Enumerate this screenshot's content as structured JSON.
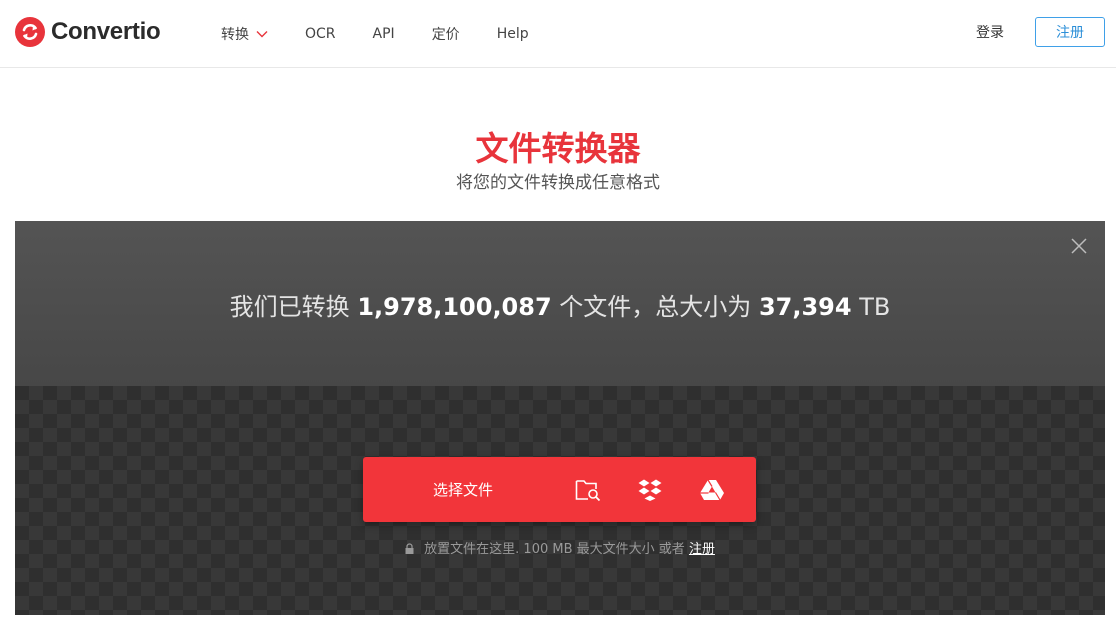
{
  "header": {
    "logo_text": "Convertio",
    "logo_icon": "convertio-logo-icon",
    "nav": [
      {
        "label": "转换",
        "has_dropdown": true
      },
      {
        "label": "OCR"
      },
      {
        "label": "API"
      },
      {
        "label": "定价"
      },
      {
        "label": "Help"
      }
    ],
    "login_label": "登录",
    "signup_label": "注册"
  },
  "hero": {
    "title": "文件转换器",
    "subtitle": "将您的文件转换成任意格式"
  },
  "stats": {
    "prefix": "我们已转换",
    "files_count": "1,978,100,087",
    "middle": "个文件，总大小为",
    "total_size": "37,394",
    "unit": "TB"
  },
  "upload": {
    "choose_label": "选择文件",
    "sources": [
      "folder-search-icon",
      "dropbox-icon",
      "google-drive-icon"
    ],
    "hint_prefix": "放置文件在这里. 100 MB 最大文件大小 或者",
    "hint_link": "注册"
  },
  "colors": {
    "accent": "#e8343b",
    "button_red": "#f2353a",
    "signup_blue": "#2c8fd8"
  }
}
